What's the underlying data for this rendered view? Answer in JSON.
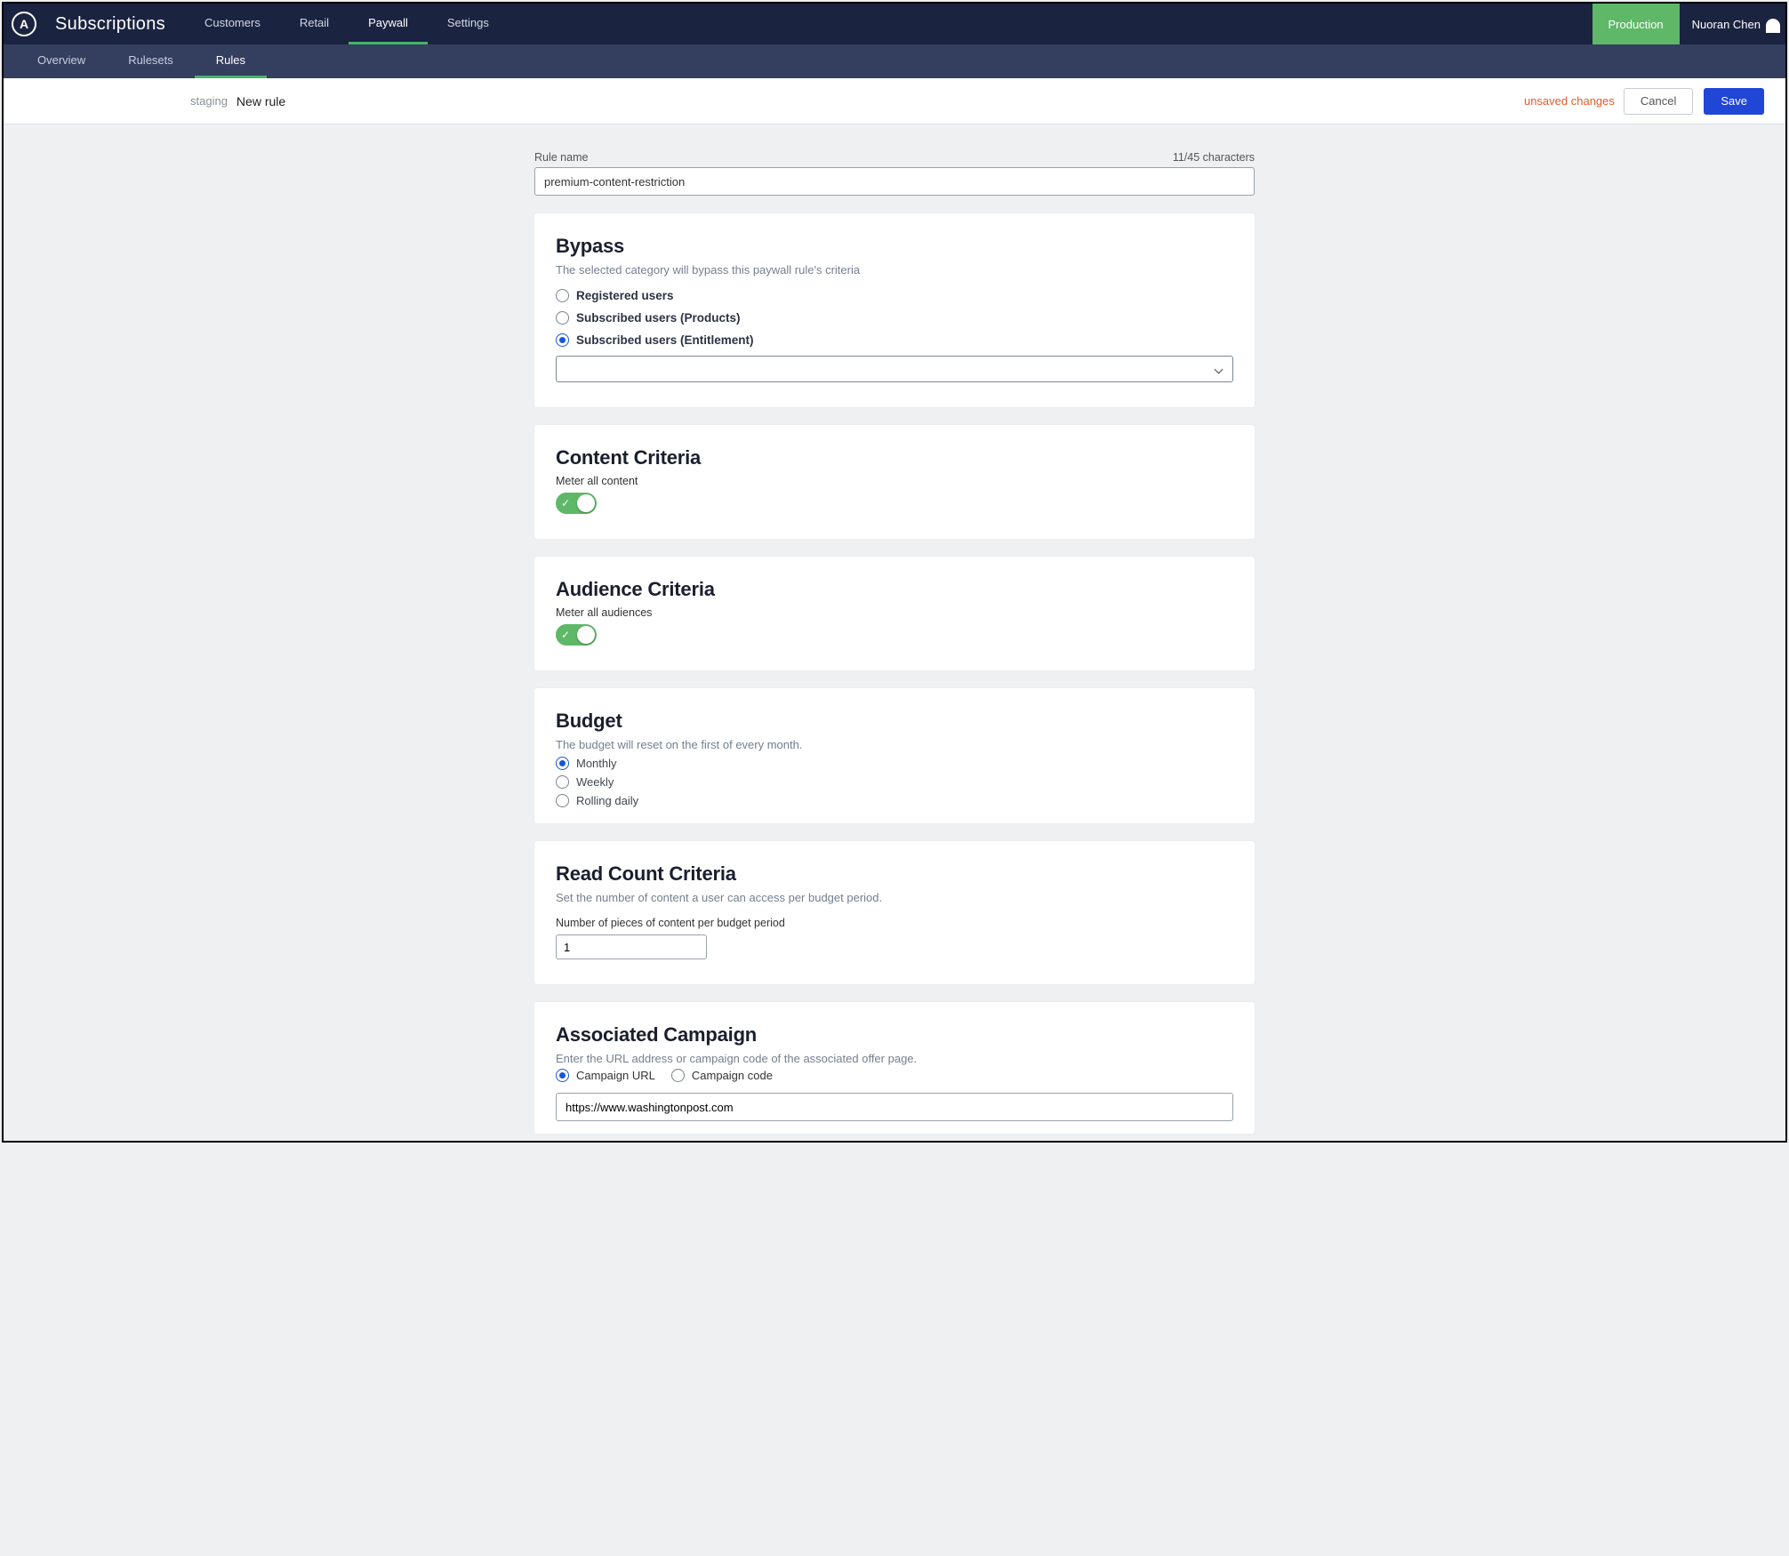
{
  "header": {
    "app_title": "Subscriptions",
    "nav": [
      {
        "label": "Customers",
        "active": false
      },
      {
        "label": "Retail",
        "active": false
      },
      {
        "label": "Paywall",
        "active": true
      },
      {
        "label": "Settings",
        "active": false
      }
    ],
    "environment": "Production",
    "user_name": "Nuoran Chen"
  },
  "subnav": [
    {
      "label": "Overview",
      "active": false
    },
    {
      "label": "Rulesets",
      "active": false
    },
    {
      "label": "Rules",
      "active": true
    }
  ],
  "pagebar": {
    "env": "staging",
    "title": "New rule",
    "unsaved_text": "unsaved changes",
    "cancel_label": "Cancel",
    "save_label": "Save"
  },
  "rule_name": {
    "label": "Rule name",
    "value": "premium-content-restriction",
    "counter": "11/45 characters"
  },
  "bypass": {
    "heading": "Bypass",
    "desc": "The selected category will bypass this paywall rule's criteria",
    "options": [
      {
        "label": "Registered users",
        "checked": false
      },
      {
        "label": "Subscribed users (Products)",
        "checked": false
      },
      {
        "label": "Subscribed users (Entitlement)",
        "checked": true
      }
    ],
    "select_value": ""
  },
  "content_criteria": {
    "heading": "Content Criteria",
    "toggle_label": "Meter all content",
    "toggle_on": true
  },
  "audience_criteria": {
    "heading": "Audience Criteria",
    "toggle_label": "Meter all audiences",
    "toggle_on": true
  },
  "budget": {
    "heading": "Budget",
    "desc": "The budget will reset on the first of every month.",
    "options": [
      {
        "label": "Monthly",
        "checked": true
      },
      {
        "label": "Weekly",
        "checked": false
      },
      {
        "label": "Rolling daily",
        "checked": false
      }
    ]
  },
  "read_count": {
    "heading": "Read Count Criteria",
    "desc": "Set the number of content a user can access per budget period.",
    "field_label": "Number of pieces of content per budget period",
    "value": "1"
  },
  "campaign": {
    "heading": "Associated Campaign",
    "desc": "Enter the URL address or campaign code of the associated offer page.",
    "options": [
      {
        "label": "Campaign URL",
        "checked": true
      },
      {
        "label": "Campaign code",
        "checked": false
      }
    ],
    "url_value": "https://www.washingtonpost.com"
  }
}
